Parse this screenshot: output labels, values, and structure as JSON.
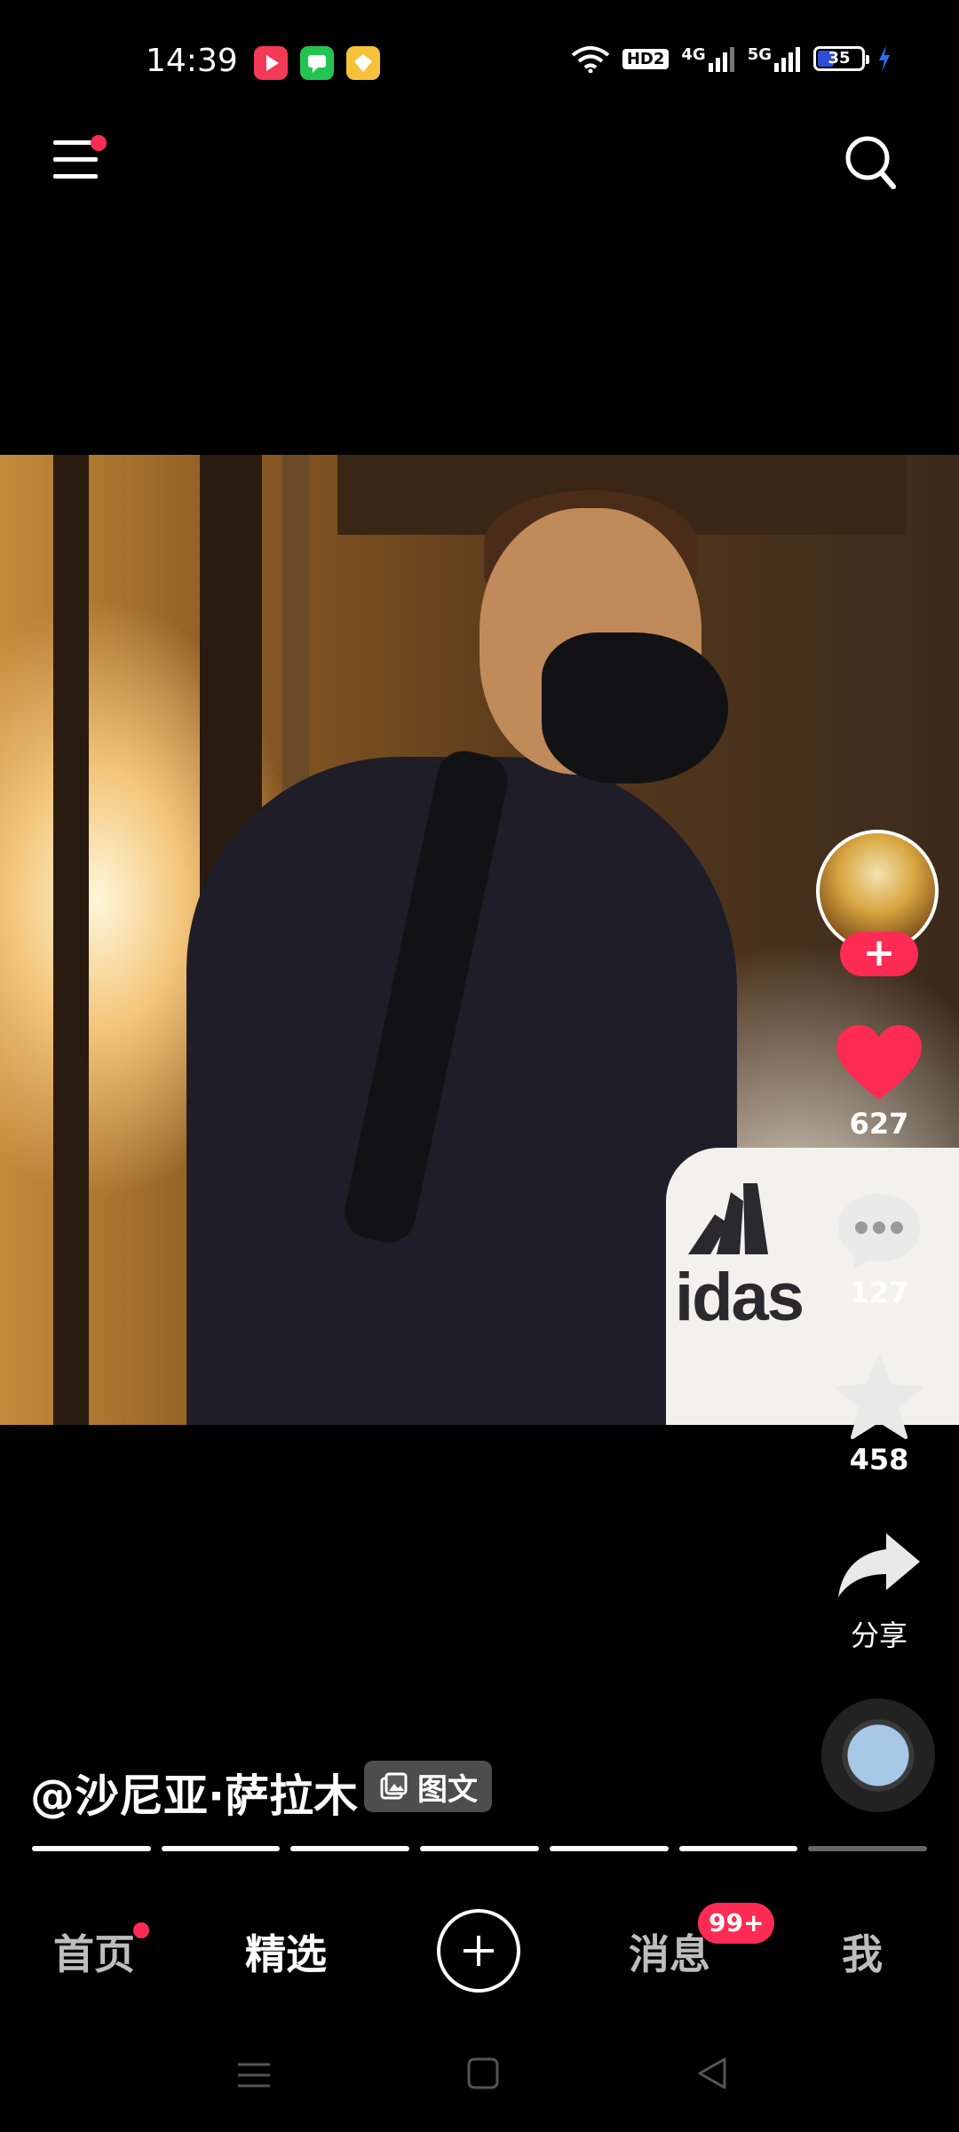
{
  "status_bar": {
    "time": "14:39",
    "network_hd": "HD2",
    "network_1": "4G",
    "network_2": "5G",
    "battery": "35"
  },
  "post": {
    "likes": "627",
    "comments": "127",
    "favorites": "458",
    "share_label": "分享",
    "author": "@沙尼亚·萨拉木",
    "tag_label": "图文",
    "brand_text": "idas"
  },
  "progress": {
    "segments": 7,
    "active": 6
  },
  "tabs": {
    "home": "首页",
    "featured": "精选",
    "messages": "消息",
    "messages_badge": "99+",
    "me": "我"
  },
  "colors": {
    "accent": "#fe2c55",
    "like": "#fe2c55"
  }
}
